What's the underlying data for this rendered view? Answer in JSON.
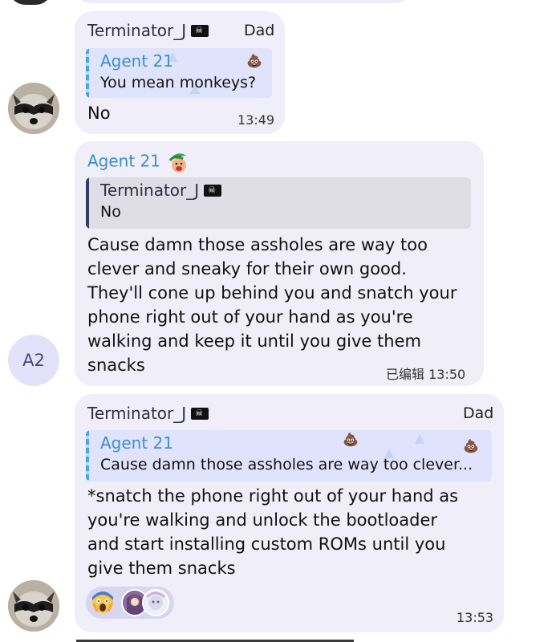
{
  "messages": [
    {
      "sender": "Terminator_J",
      "tag": "Dad",
      "reply_to": {
        "name": "Agent 21",
        "text": "You mean monkeys?"
      },
      "lines": [
        "No"
      ],
      "time": "13:49"
    },
    {
      "sender": "Agent 21",
      "avatar_text": "A2",
      "reply_to": {
        "name": "Terminator_J",
        "text": "No"
      },
      "lines": [
        "Cause damn those assholes are way too",
        "clever and sneaky for their own good.",
        "They'll cone up behind you and snatch your",
        "phone right out of your hand as you're",
        "walking and keep it until you give them",
        "snacks"
      ],
      "time": "已编辑 13:50"
    },
    {
      "sender": "Terminator_J",
      "tag": "Dad",
      "reply_to": {
        "name": "Agent 21",
        "text": "Cause damn those assholes are way too clever..."
      },
      "lines": [
        "*snatch the phone right out of your hand as",
        "you're walking and unlock the bootloader",
        "and start installing custom ROMs until you",
        "give them snacks"
      ],
      "time": "13:53"
    }
  ],
  "colors": {
    "bubble": "#efeef9",
    "agent_name": "#3a8fd0",
    "terminator_name": "#2f2f45",
    "reply_bar": "#4da3dc",
    "reply_bar_dark": "#3b3966"
  },
  "icons": {
    "flag": "pirate-flag-icon",
    "agent_emoji": "palm-tree-face-emoji-icon",
    "reaction": "screaming-face-emoji-icon"
  }
}
